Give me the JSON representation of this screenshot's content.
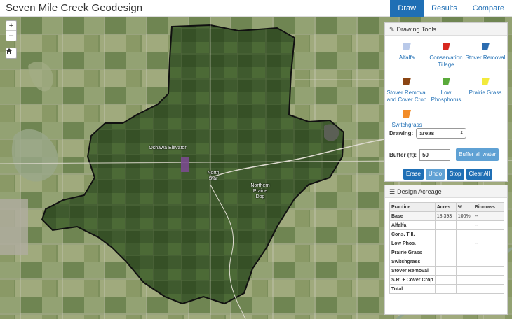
{
  "header": {
    "title": "Seven Mile Creek Geodesign"
  },
  "nav": {
    "tabs": [
      "Draw",
      "Results",
      "Compare"
    ],
    "active": "Draw"
  },
  "map": {
    "zoom_in": "+",
    "zoom_out": "–",
    "labels": {
      "elevator": "Oshawa Elevator",
      "north_star": "North Star",
      "prairie_dog": "Northern Prairie Dog"
    }
  },
  "drawing_tools": {
    "title": "Drawing Tools",
    "practices": [
      {
        "label": "Alfalfa",
        "color": "#b9c9e9"
      },
      {
        "label": "Conservation Tillage",
        "color": "#d7281f"
      },
      {
        "label": "Stover Removal",
        "color": "#2b6cb0"
      },
      {
        "label": "Stover Removal and Cover Crop",
        "color": "#8b4513"
      },
      {
        "label": "Low Phosphorus",
        "color": "#5aaa3a"
      },
      {
        "label": "Prairie Grass",
        "color": "#f2ea3c"
      },
      {
        "label": "Switchgrass",
        "color": "#f28c28"
      }
    ],
    "drawing_label": "Drawing:",
    "drawing_value": "areas",
    "buffer_label": "Buffer (ft):",
    "buffer_value": "50",
    "buffer_button": "Buffer all water",
    "buttons": {
      "erase": "Erase",
      "undo": "Undo",
      "stop": "Stop",
      "clear": "Clear All"
    }
  },
  "design_acreage": {
    "title": "Design Acreage",
    "columns": [
      "Practice",
      "Acres",
      "%",
      "Biomass"
    ],
    "rows": [
      [
        "Base",
        "18,393",
        "100%",
        "--"
      ],
      [
        "Alfalfa",
        "",
        "",
        "--"
      ],
      [
        "Cons. Till.",
        "",
        "",
        ""
      ],
      [
        "Low Phos.",
        "",
        "",
        "--"
      ],
      [
        "Prairie Grass",
        "",
        "",
        ""
      ],
      [
        "Switchgrass",
        "",
        "",
        ""
      ],
      [
        "Stover Removal",
        "",
        "",
        ""
      ],
      [
        "S.R. + Cover Crop",
        "",
        "",
        ""
      ],
      [
        "Total",
        "",
        "",
        ""
      ]
    ]
  }
}
